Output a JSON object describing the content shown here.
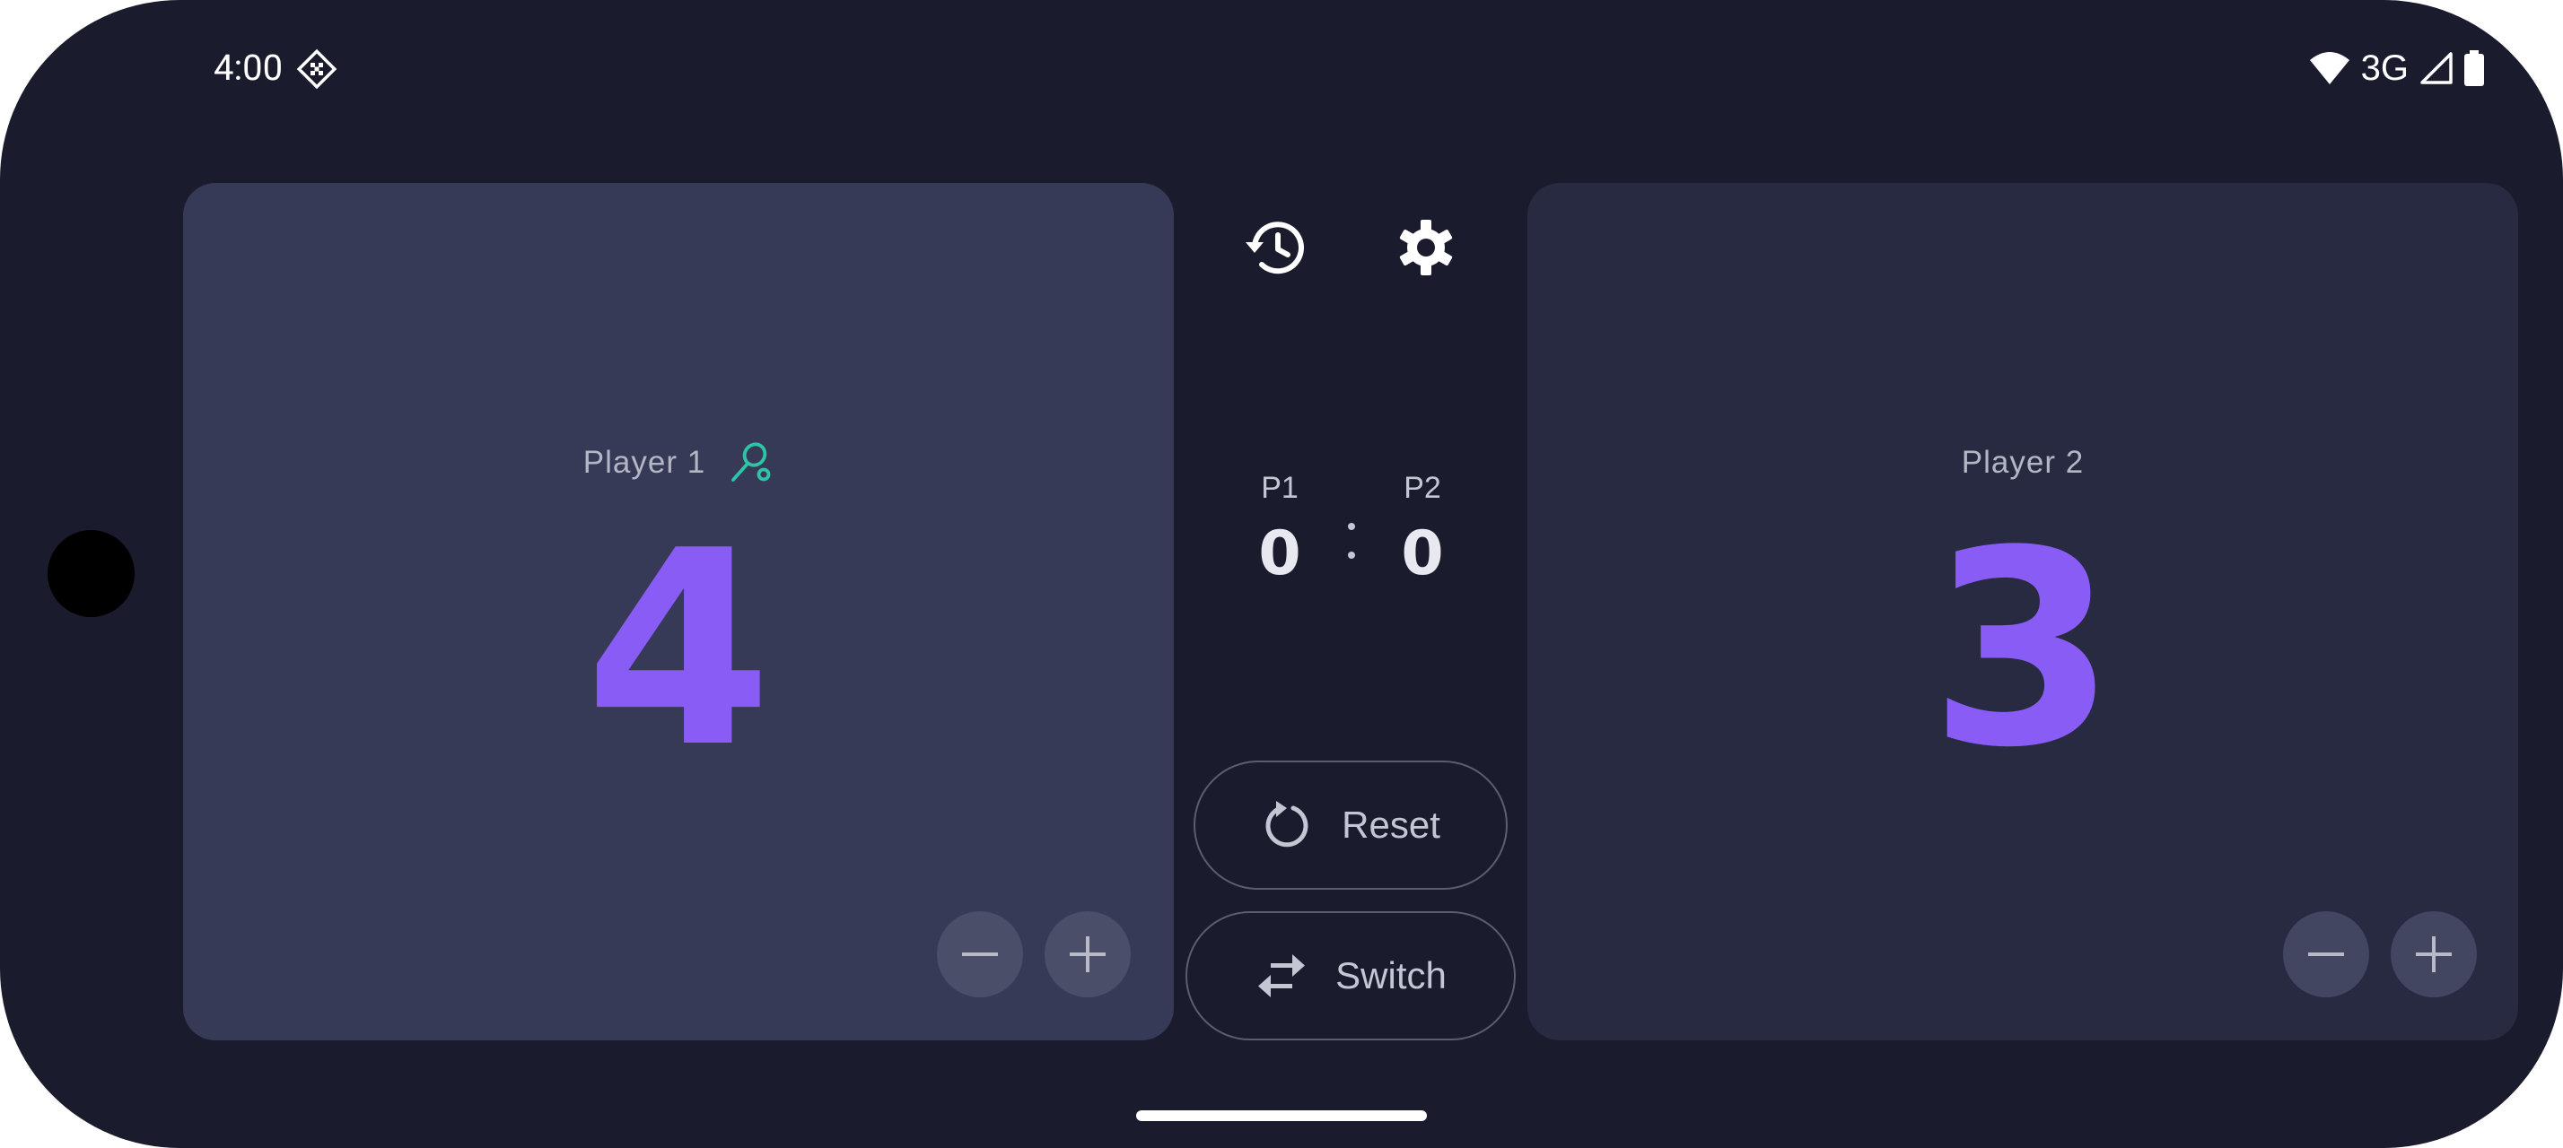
{
  "status_bar": {
    "time": "4:00",
    "network": "3G"
  },
  "player1": {
    "name": "Player 1",
    "score": "4",
    "serving": true
  },
  "player2": {
    "name": "Player 2",
    "score": "3",
    "serving": false
  },
  "sets": {
    "p1_label": "P1",
    "p2_label": "P2",
    "p1_value": "0",
    "p2_value": "0"
  },
  "buttons": {
    "reset_label": "Reset",
    "switch_label": "Switch"
  },
  "colors": {
    "background": "#1a1c2e",
    "panel_active": "#363a57",
    "panel_inactive": "#272a40",
    "score_accent": "#8a5cf6",
    "serve_indicator": "#2ec4a6"
  },
  "icons": {
    "history": "history-icon",
    "settings": "gear-icon",
    "reset": "reset-icon",
    "switch": "swap-icon",
    "serve": "tennis-racket-icon",
    "decrement": "minus-icon",
    "increment": "plus-icon"
  }
}
